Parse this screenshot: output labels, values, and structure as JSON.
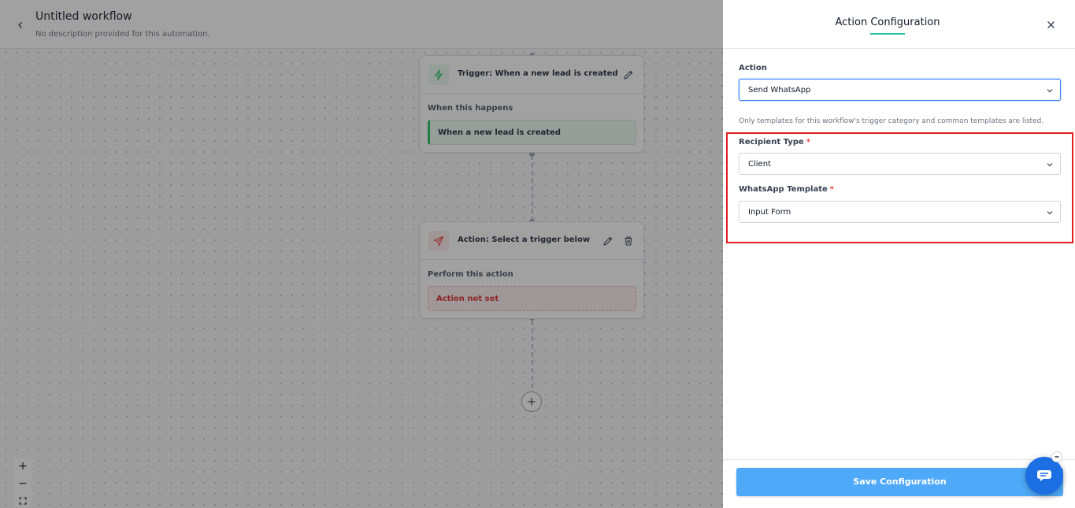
{
  "workflow": {
    "title": "Untitled workflow",
    "description": "No description provided for this automation."
  },
  "trigger_node": {
    "title": "Trigger: When a new lead is created",
    "section_label": "When this happens",
    "value": "When a new lead is created",
    "icon": "lightning-icon"
  },
  "action_node": {
    "title": "Action: Select a trigger below",
    "section_label": "Perform this action",
    "value": "Action not set",
    "icon": "send-icon"
  },
  "zoom": {
    "in": "+",
    "out": "−"
  },
  "panel": {
    "title": "Action Configuration",
    "action_label": "Action",
    "action_value": "Send WhatsApp",
    "hint": "Only templates for this workflow's trigger category and common templates are listed.",
    "recipient_label": "Recipient Type",
    "recipient_value": "Client",
    "template_label": "WhatsApp Template",
    "template_value": "Input Form",
    "required_mark": "*",
    "save_label": "Save Configuration"
  },
  "colors": {
    "accent": "#22c3a6",
    "save_button": "#4ea9f8",
    "highlight": "#e11d1d",
    "trigger_green": "#22c55e",
    "action_red": "#ef4444"
  }
}
